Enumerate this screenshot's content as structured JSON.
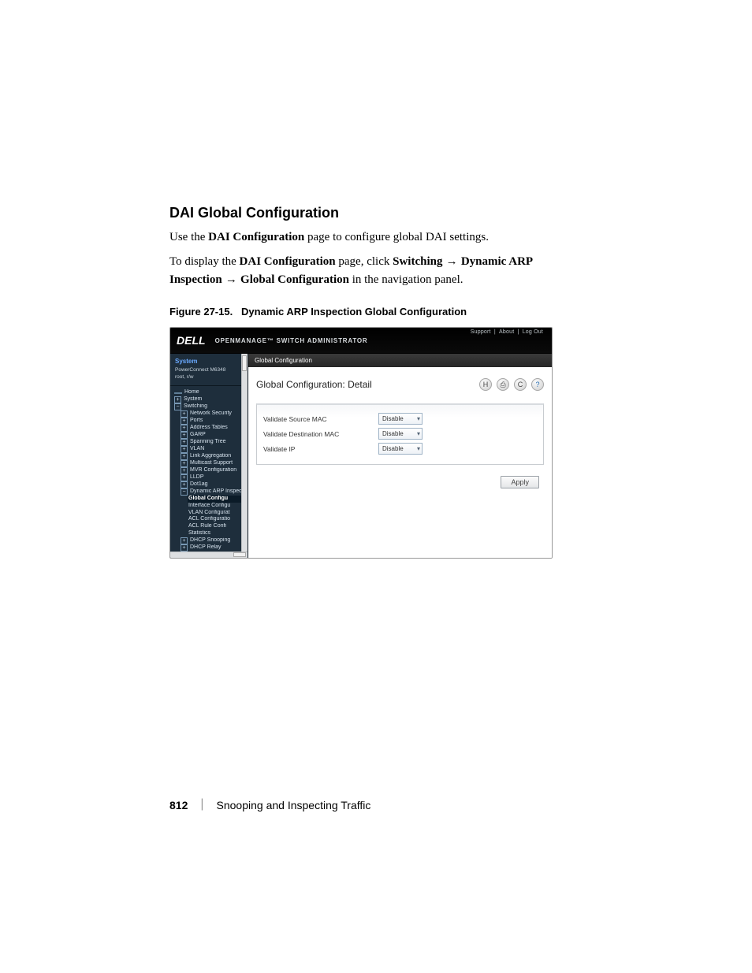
{
  "doc": {
    "heading": "DAI Global Configuration",
    "para1_pre": "Use the ",
    "para1_bold": "DAI Configuration",
    "para1_post": " page to configure global DAI settings.",
    "para2_pre": "To display the ",
    "para2_bold": "DAI Configuration",
    "para2_mid": " page, click ",
    "para2_b2": "Switching",
    "para2_arrow1": " → ",
    "para2_b3": "Dynamic ARP Inspection",
    "para2_arrow2": " → ",
    "para2_b4": "Global Configuration",
    "para2_post": " in the navigation panel.",
    "fig_label": "Figure 27-15.",
    "fig_title": "Dynamic ARP Inspection Global Configuration"
  },
  "app": {
    "logo": "DELL",
    "product": "OPENMANAGE™ SWITCH ADMINISTRATOR",
    "toplinks": {
      "support": "Support",
      "sep": "|",
      "about": "About",
      "logout": "Log Out"
    },
    "nav_header": {
      "system": "System",
      "device": "PowerConnect M6348",
      "user": "root, r/w"
    },
    "crumb": "Global Configuration",
    "panel_title": "Global Configuration: Detail",
    "icons": {
      "save": "H",
      "print": "⎙",
      "refresh": "C",
      "help": "?"
    },
    "form": {
      "row1_label": "Validate Source MAC",
      "row2_label": "Validate Destination MAC",
      "row3_label": "Validate IP",
      "select_value": "Disable"
    },
    "apply": "Apply"
  },
  "tree": {
    "home": "Home",
    "system": "System",
    "switching": "Switching",
    "net_sec": "Network Security",
    "ports": "Ports",
    "addr_tables": "Address Tables",
    "garp": "GARP",
    "spanning": "Spanning Tree",
    "vlan": "VLAN",
    "linkagg": "Link Aggregation",
    "multicast": "Multicast Support",
    "mvr": "MVR Configuration",
    "lldp": "LLDP",
    "dot1ag": "Dot1ag",
    "dai": "Dynamic ARP Inspec",
    "global": "Global Configu",
    "iface": "Interface Configu",
    "vlan_cfg": "VLAN Configurat",
    "acl_cfg": "ACL Configuratio",
    "acl_rule": "ACL Rule Confi",
    "stats": "Statistics",
    "dhcp": "DHCP Snooping",
    "dhcp_relay": "DHCP Relay"
  },
  "footer": {
    "page": "812",
    "chapter": "Snooping and Inspecting Traffic"
  }
}
